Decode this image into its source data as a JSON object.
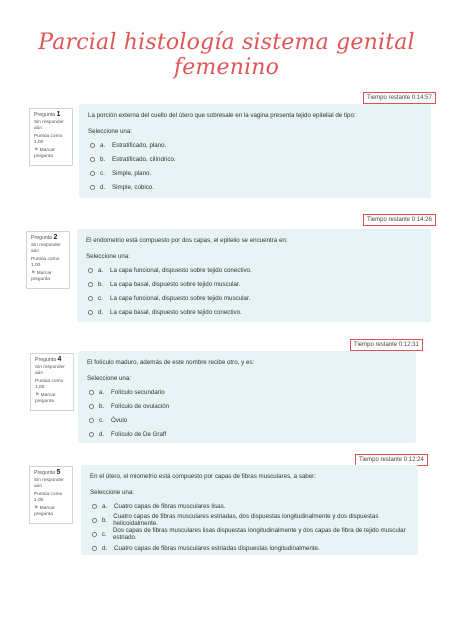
{
  "title": "Parcial histología sistema genital femenino",
  "questions": [
    {
      "timer": "Tiempo restante 0:14:57",
      "label": "Pregunta",
      "number": "1",
      "status": "Sin responder aún",
      "score": "Puntúa como 1,00",
      "flag": "Marcar pregunta",
      "text": "La porción externa del cuello del útero que sobresale en la vagina presenta tejido epitelial de tipo:",
      "prompt": "Seleccione una:",
      "options": [
        {
          "letter": "a.",
          "text": "Estratificado, plano."
        },
        {
          "letter": "b.",
          "text": "Estratificado, cilíndrico."
        },
        {
          "letter": "c.",
          "text": "Simple, plano."
        },
        {
          "letter": "d.",
          "text": "Simple, cúbico."
        }
      ]
    },
    {
      "timer": "Tiempo restante 0:14:26",
      "label": "Pregunta",
      "number": "2",
      "status": "Sin responder aún",
      "score": "Puntúa como 1,00",
      "flag": "Marcar pregunta",
      "text": "El endometrio está compuesto por dos capas, el epitelio se encuentra en:",
      "prompt": "Seleccione una:",
      "options": [
        {
          "letter": "a.",
          "text": "La capa funcional, dispuesto sobre tejido conectivo."
        },
        {
          "letter": "b.",
          "text": "La capa basal, dispuesto sobre tejido muscular."
        },
        {
          "letter": "c.",
          "text": "La capa funcional, dispuesto sobre tejido muscular."
        },
        {
          "letter": "d.",
          "text": "La capa basal, dispuesto sobre tejido conectivo."
        }
      ]
    },
    {
      "timer": "Tiempo restante 0:12:31",
      "label": "Pregunta",
      "number": "4",
      "status": "Sin responder aún",
      "score": "Puntúa como 1,00",
      "flag": "Marcar pregunta",
      "text": "El folículo maduro, además de este nombre recibe otro, y es:",
      "prompt": "Seleccione una:",
      "options": [
        {
          "letter": "a.",
          "text": "Folículo secundario"
        },
        {
          "letter": "b.",
          "text": "Folículo de ovulación"
        },
        {
          "letter": "c.",
          "text": "Óvulo"
        },
        {
          "letter": "d.",
          "text": "Folículo de De Graff"
        }
      ]
    },
    {
      "timer": "Tiempo restante 0:12:24",
      "label": "Pregunta",
      "number": "5",
      "status": "Sin responder aún",
      "score": "Puntúa como 1,00",
      "flag": "Marcar pregunta",
      "text": "En el útero, el miometrio está compuesto por capas de fibras musculares, a saber:",
      "prompt": "Seleccione una:",
      "options": [
        {
          "letter": "a.",
          "text": "Cuatro capas de fibras musculares lisas."
        },
        {
          "letter": "b.",
          "text": "Cuatro capas de fibras musculares estriadas, dos dispuestas longitudinalmente y dos dispuestas helicoidalmente."
        },
        {
          "letter": "c.",
          "text": "Dos capas de fibras musculares lisas dispuestas longitudinalmente y dos capas de fibra de tejido muscular estriado."
        },
        {
          "letter": "d.",
          "text": "Cuatro capas de fibras musculares estriadas dispuestas longitudinalmente."
        }
      ]
    }
  ],
  "colors": {
    "accent": "#e05555",
    "panel": "#e7f3f5",
    "timer_border": "#d9534f"
  },
  "icons": {
    "radio": "radio-button-icon",
    "flag": "flag-icon"
  }
}
